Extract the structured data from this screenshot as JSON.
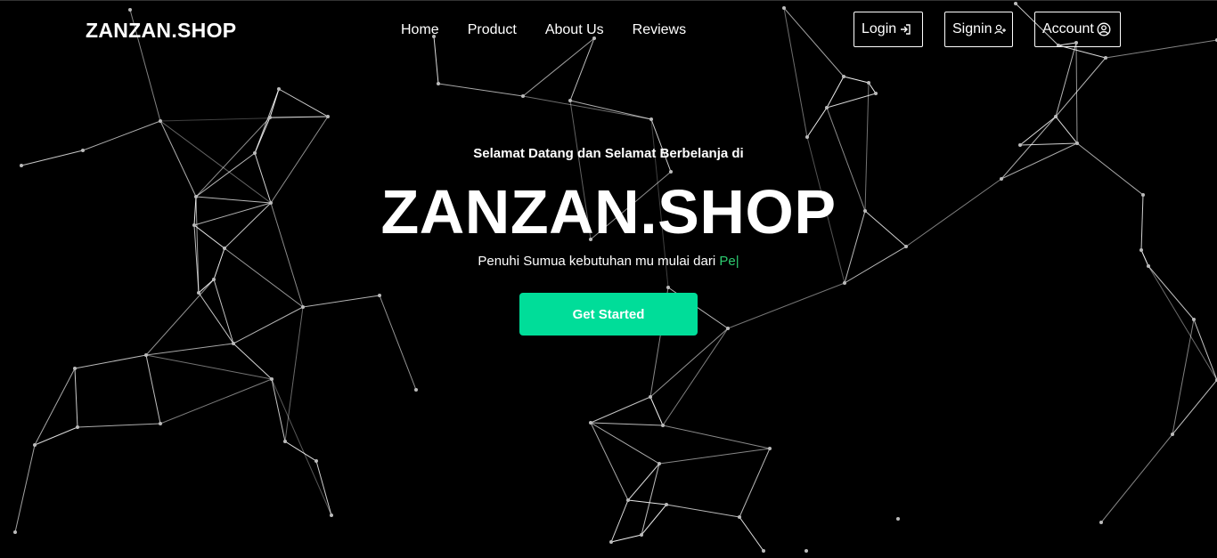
{
  "navbar": {
    "brand": "ZANZAN.SHOP",
    "links": {
      "home": "Home",
      "product": "Product",
      "about": "About Us",
      "reviews": "Reviews"
    },
    "buttons": {
      "login": "Login",
      "signin": "Signin",
      "account": "Account"
    },
    "icons": {
      "login": "login-arrow-icon",
      "signin": "user-plus-icon",
      "account": "user-circle-icon"
    }
  },
  "hero": {
    "welcome": "Selamat Datang dan Selamat Berbelanja di",
    "title": "ZANZAN.SHOP",
    "tagline_prefix": "Penuhi Sumua kebutuhan mu mulai dari ",
    "tagline_typed": "Pe",
    "cta_label": "Get Started"
  },
  "colors": {
    "background": "#000000",
    "accent": "#00dd99",
    "typed_text": "#2ecc71",
    "network_line": "#ffffff"
  }
}
